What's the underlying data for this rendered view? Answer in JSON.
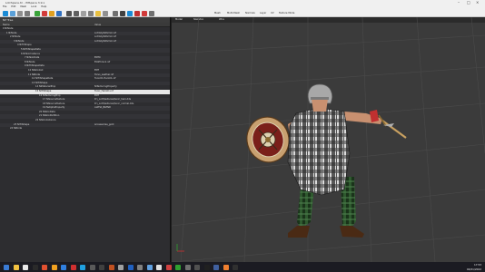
{
  "window": {
    "title": "LotrSpace.tri - IMSpace 3.9.x"
  },
  "menu": [
    "File",
    "Edit",
    "Mesh",
    "Look",
    "Help"
  ],
  "toolbar": {
    "icon_colors": [
      "#1a8ad4",
      "#5aa0d8",
      "#8e8e8e",
      "#7a7a7a",
      "#3aa43a",
      "#d23a3a",
      "#e0a020",
      "#3070c0",
      "#505050",
      "#606060",
      "#a0a0a0",
      "#808080",
      "#e8c040",
      "#909090",
      "#707070",
      "#404040",
      "#1a8ad4",
      "#c03030",
      "#d23a3a",
      "#707070"
    ],
    "labels": [
      "Mesh",
      "Multi-Mesh",
      "Normals",
      "Layer",
      "UV",
      "Texture Mode"
    ]
  },
  "left_panel": {
    "title": "Nif Tree",
    "columns": [
      "Name",
      "Value"
    ],
    "rows": [
      {
        "name": "0 NiNode",
        "value": "",
        "indent": 0,
        "sel": false
      },
      {
        "name": "1 NiNode",
        "value": "LotrAlly0Warrior.nif",
        "indent": 1,
        "sel": false
      },
      {
        "name": "2 NiNode",
        "value": "LotrAlly0Warrior.nif",
        "indent": 2,
        "sel": false
      },
      {
        "name": "3 NiNode",
        "value": "LotrAlly0Warrior.nif",
        "indent": 3,
        "sel": false
      },
      {
        "name": "4 NiTriShape",
        "value": "",
        "indent": 4,
        "sel": false
      },
      {
        "name": "5 NiTriShapeData",
        "value": "",
        "indent": 5,
        "sel": false
      },
      {
        "name": "6 NiSkinInstance",
        "value": "",
        "indent": 5,
        "sel": false
      },
      {
        "name": "7 NiSkinData",
        "value": "ENT0",
        "indent": 6,
        "sel": false
      },
      {
        "name": "8 NiNode",
        "value": "EG9Torso1.nif",
        "indent": 6,
        "sel": false
      },
      {
        "name": "9 NiTriShapeData",
        "value": "",
        "indent": 6,
        "sel": false
      },
      {
        "name": "10 NiSkinInst",
        "value": "ENT",
        "indent": 7,
        "sel": false
      },
      {
        "name": "11 NiNode",
        "value": "Torso_Leather.nif",
        "indent": 7,
        "sel": false
      },
      {
        "name": "12 NiTriShapeData",
        "value": "Tunic01.Hero01.nif",
        "indent": 8,
        "sel": false
      },
      {
        "name": "13 NiTriShape",
        "value": "",
        "indent": 8,
        "sel": false
      },
      {
        "name": "14 NiMaterialProp",
        "value": "NiTexturingProperty",
        "indent": 9,
        "sel": false
      },
      {
        "name": "15 NiTriShape",
        "value": "Tunic_Hero01.nif",
        "indent": 9,
        "sel": true
      },
      {
        "name": "16 NiTexturingProp",
        "value": "ENT",
        "indent": 10,
        "sel": false
      },
      {
        "name": "17 NiSourceTexture",
        "value": "D:\\_Lotr\\textures\\tunic_hero.dds",
        "indent": 11,
        "sel": false
      },
      {
        "name": "18 NiSourceTexture",
        "value": "D:\\_Lotr\\textures\\tunic_normal.dds",
        "indent": 11,
        "sel": false
      },
      {
        "name": "19 NiAlphaProperty",
        "value": "ALPHA_BLEND",
        "indent": 11,
        "sel": false
      },
      {
        "name": "20 NiSkinData",
        "value": "",
        "indent": 10,
        "sel": false
      },
      {
        "name": "21 NiSkinPartition",
        "value": "",
        "indent": 10,
        "sel": false
      },
      {
        "name": "22 NiSkinInstance",
        "value": "",
        "indent": 9,
        "sel": false
      },
      {
        "name": "23 NiTriShape",
        "value": "Accessories_gold",
        "indent": 3,
        "sel": false
      },
      {
        "name": "24 NiNode",
        "value": "",
        "indent": 2,
        "sel": false
      }
    ]
  },
  "viewport": {
    "toolbar": [
      "Model",
      "Skeleton",
      "Wire"
    ]
  },
  "taskbar": {
    "icon_colors": [
      "#3a7bd5",
      "#f0c040",
      "#e8e8e8",
      "#2a2a2a",
      "#e05030",
      "#f0a020",
      "#3080e0",
      "#d03030",
      "#20a0e0",
      "#5a5a5a",
      "#404040",
      "#c05020",
      "#a0a0a0",
      "#2060c0",
      "#808080",
      "#60a0e0",
      "#e0e0e0",
      "#d04040",
      "#30a030",
      "#707070",
      "#505050",
      "#202020",
      "#4060a0",
      "#f08030",
      "#303030"
    ],
    "time": "17:53",
    "date": "04/01/2022"
  }
}
